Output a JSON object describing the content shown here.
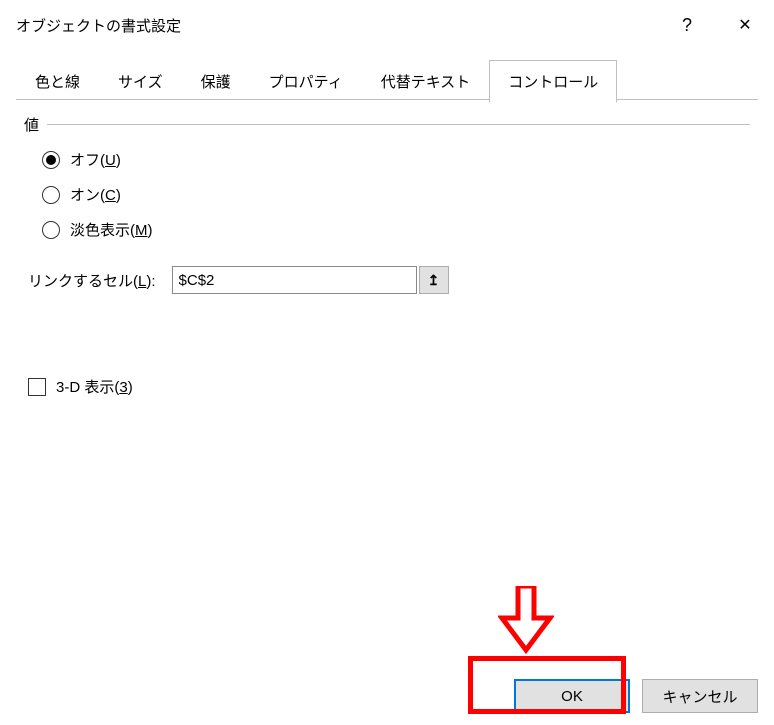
{
  "title": "オブジェクトの書式設定",
  "help_symbol": "?",
  "close_symbol": "✕",
  "tabs": [
    {
      "label": "色と線"
    },
    {
      "label": "サイズ"
    },
    {
      "label": "保護"
    },
    {
      "label": "プロパティ"
    },
    {
      "label": "代替テキスト"
    },
    {
      "label": "コントロール"
    }
  ],
  "group": {
    "value_label": "値"
  },
  "radios": {
    "off_pre": "オフ(",
    "off_key": "U",
    "off_post": ")",
    "on_pre": "オン(",
    "on_key": "C",
    "on_post": ")",
    "mixed_pre": "淡色表示(",
    "mixed_key": "M",
    "mixed_post": ")"
  },
  "link": {
    "label_pre": "リンクするセル(",
    "label_key": "L",
    "label_post": "):",
    "value": "$C$2",
    "picker_icon": "↥"
  },
  "checkbox": {
    "label_pre": "3-D 表示(",
    "label_key": "3",
    "label_post": ")"
  },
  "buttons": {
    "ok": "OK",
    "cancel": "キャンセル"
  }
}
